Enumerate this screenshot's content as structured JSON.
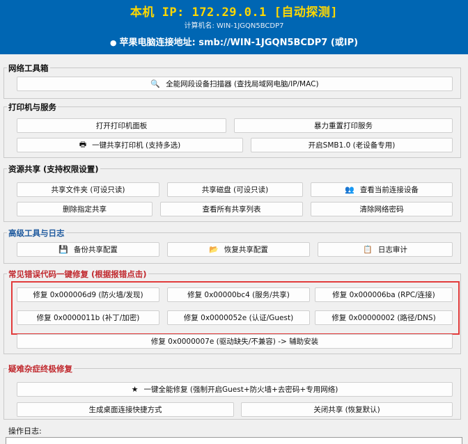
{
  "header": {
    "ip_line": "本机 IP: 172.29.0.1 [自动探测]",
    "hostname_line": "计算机名: WIN-1JGQN5BCDP7",
    "apple_icon": "apple-icon",
    "smb_line": "苹果电脑连接地址: smb://WIN-1JGQN5BCDP7 (或IP)",
    "bg_color": "#0066b3",
    "ip_color": "#ffd800"
  },
  "network_tools": {
    "title": "网络工具箱",
    "scanner_label": "全能网段设备扫描器 (查找局域网电脑/IP/MAC)",
    "scanner_icon": "magnifier-icon"
  },
  "printer": {
    "title": "打印机与服务",
    "open_panel_label": "打开打印机面板",
    "reset_service_label": "暴力重置打印服务",
    "share_printer_label": "一键共享打印机 (支持多选)",
    "share_printer_icon": "printer-icon",
    "smb1_label": "开启SMB1.0 (老设备专用)"
  },
  "sharing": {
    "title": "资源共享 (支持权限设置)",
    "share_folder_label": "共享文件夹 (可设只读)",
    "share_disk_label": "共享磁盘 (可设只读)",
    "view_connections_label": "查看当前连接设备",
    "view_connections_icon": "users-icon",
    "delete_share_label": "删除指定共享",
    "list_shares_label": "查看所有共享列表",
    "clear_password_label": "清除网络密码"
  },
  "advanced": {
    "title": "高级工具与日志",
    "backup_label": "备份共享配置",
    "backup_icon": "save-icon",
    "restore_label": "恢复共享配置",
    "restore_icon": "folder-open-icon",
    "audit_label": "日志审计",
    "audit_icon": "log-icon"
  },
  "errors": {
    "title": "常见错误代码一键修复 (根据报错点击)",
    "fix_6d9": "修复 0x000006d9 (防火墙/发现)",
    "fix_bc4": "修复 0x00000bc4 (服务/共享)",
    "fix_6ba": "修复 0x000006ba (RPC/连接)",
    "fix_11b": "修复 0x0000011b (补丁/加密)",
    "fix_52e": "修复 0x0000052e (认证/Guest)",
    "fix_002": "修复 0x00000002 (路径/DNS)",
    "fix_07e": "修复 0x0000007e (驱动缺失/不兼容) -> 辅助安装",
    "highlight_color": "#e23b3b"
  },
  "ultimate": {
    "title": "疑难杂症终极修复",
    "full_fix_label": "一键全能修复 (强制开启Guest+防火墙+去密码+专用网络)",
    "full_fix_icon": "star-icon",
    "shortcut_label": "生成桌面连接快捷方式",
    "close_share_label": "关闭共享 (恢复默认)"
  },
  "log": {
    "label": "操作日志:"
  }
}
